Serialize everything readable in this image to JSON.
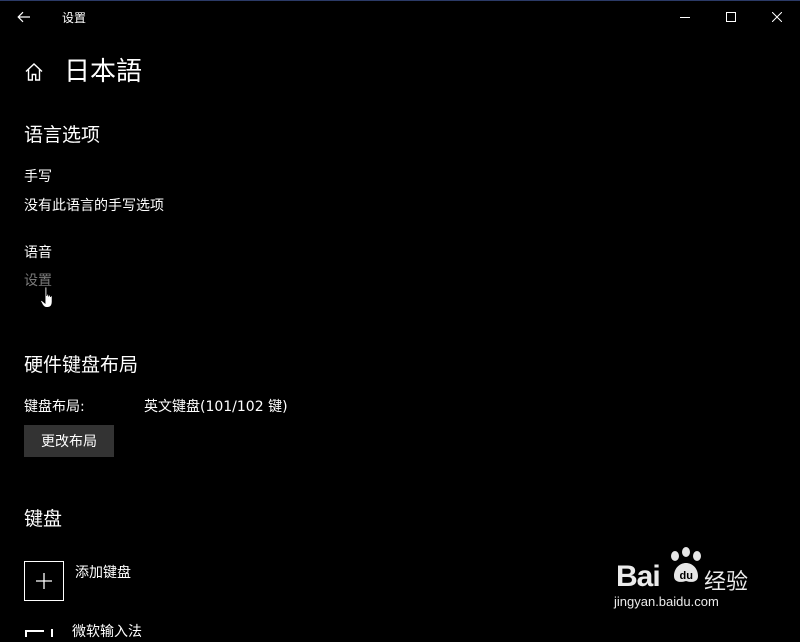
{
  "window": {
    "title": "设置",
    "back_icon": "arrow-left-icon",
    "minimize_icon": "minimize-icon",
    "maximize_icon": "maximize-icon",
    "close_icon": "close-icon"
  },
  "header": {
    "home_icon": "home-icon",
    "title": "日本語"
  },
  "language_options": {
    "section_title": "语言选项",
    "handwriting": {
      "label": "手写",
      "status": "没有此语言的手写选项"
    },
    "speech": {
      "label": "语音",
      "settings_link": "设置"
    }
  },
  "hardware_keyboard": {
    "section_title": "硬件键盘布局",
    "layout_label": "键盘布局:",
    "layout_value": "英文键盘(101/102 键)",
    "change_button": "更改布局"
  },
  "keyboards": {
    "section_title": "键盘",
    "add_keyboard_label": "添加键盘",
    "add_icon": "plus-icon",
    "partial_item": "微软输入法"
  },
  "watermark": {
    "brand": "Bai",
    "brand_tail": "du",
    "cn": "经验",
    "url": "jingyan.baidu.com"
  },
  "colors": {
    "background": "#000000",
    "text": "#ffffff",
    "disabled_link": "#7a7a7a",
    "button_bg": "#333333"
  }
}
